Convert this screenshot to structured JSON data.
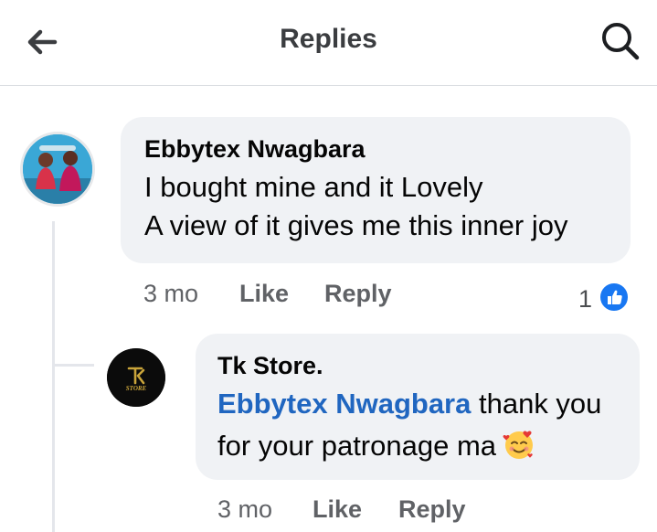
{
  "header": {
    "title": "Replies",
    "back_icon": "arrow-left-icon",
    "search_icon": "search-icon"
  },
  "comments": [
    {
      "author": "Ebbytex Nwagbara",
      "lines": [
        "I bought mine and it Lovely",
        "A view of it gives me this inner joy"
      ],
      "time": "3 mo",
      "like_label": "Like",
      "reply_label": "Reply",
      "reaction_count": "1",
      "reaction_icon": "thumbs-up-icon"
    },
    {
      "author": "Tk Store.",
      "avatar_text": "STORE",
      "mention": "Ebbytex Nwagbara",
      "line1_rest": " thank you",
      "line2": "for your patronage ma",
      "emoji": "smiling-face-with-hearts-icon",
      "time": "3 mo",
      "like_label": "Like",
      "reply_label": "Reply"
    }
  ],
  "colors": {
    "accent": "#1877f2",
    "mention": "#2066c0",
    "bubble": "#f0f2f5",
    "meta": "#606266"
  }
}
